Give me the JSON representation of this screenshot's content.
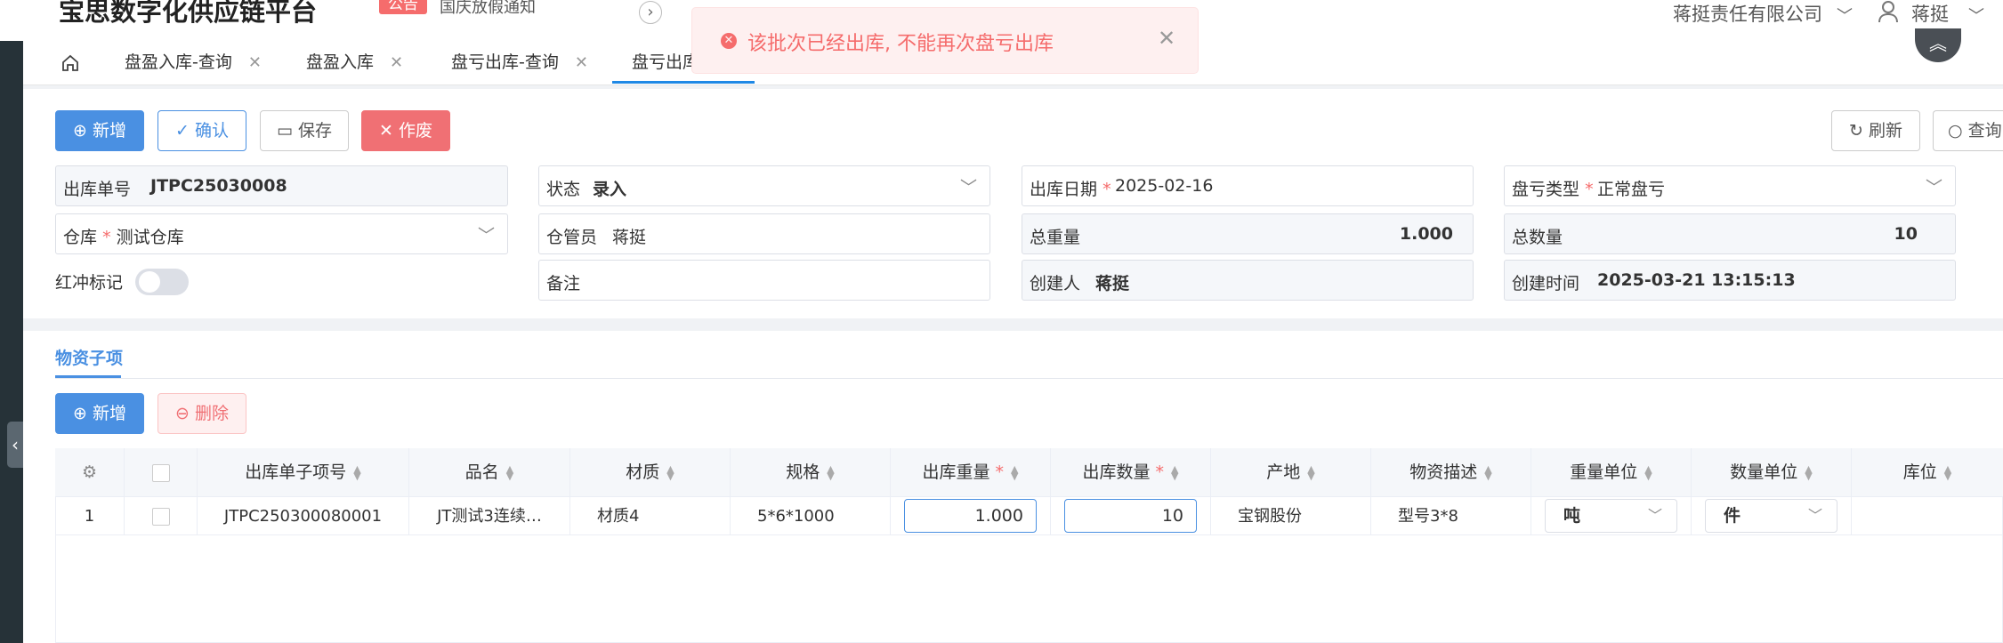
{
  "header": {
    "brand": "宝思数字化供应链平台",
    "notice_badge": "公告",
    "notice_text": "国庆放假通知",
    "company": "蒋挺责任有限公司",
    "user": "蒋挺"
  },
  "tabs": [
    {
      "label": "盘盈入库-查询"
    },
    {
      "label": "盘盈入库"
    },
    {
      "label": "盘亏出库-查询"
    },
    {
      "label": "盘亏出库"
    }
  ],
  "toast": {
    "message": "该批次已经出库, 不能再次盘亏出库"
  },
  "toolbar": {
    "add": "新增",
    "confirm": "确认",
    "save": "保存",
    "void": "作废",
    "refresh": "刷新",
    "query": "查询"
  },
  "form": {
    "order_no_label": "出库单号",
    "order_no": "JTPC25030008",
    "status_label": "状态",
    "status": "录入",
    "date_label": "出库日期",
    "date": "2025-02-16",
    "loss_type_label": "盘亏类型",
    "loss_type": "正常盘亏",
    "warehouse_label": "仓库",
    "warehouse": "测试仓库",
    "keeper_label": "仓管员",
    "keeper": "蒋挺",
    "total_weight_label": "总重量",
    "total_weight": "1.000",
    "total_qty_label": "总数量",
    "total_qty": "10",
    "red_flag_label": "红冲标记",
    "remark_label": "备注",
    "creator_label": "创建人",
    "creator": "蒋挺",
    "created_time_label": "创建时间",
    "created_time": "2025-03-21 13:15:13"
  },
  "detail": {
    "tab": "物资子项",
    "add": "新增",
    "delete": "删除",
    "columns": {
      "item_no": "出库单子项号",
      "name": "品名",
      "material": "材质",
      "spec": "规格",
      "out_weight": "出库重量",
      "out_qty": "出库数量",
      "origin": "产地",
      "desc": "物资描述",
      "weight_unit": "重量单位",
      "qty_unit": "数量单位",
      "location": "库位"
    },
    "rows": [
      {
        "index": "1",
        "item_no": "JTPC250300080001",
        "name": "JT测试3连续…",
        "material": "材质4",
        "spec": "5*6*1000",
        "out_weight": "1.000",
        "out_qty": "10",
        "origin": "宝钢股份",
        "desc": "型号3*8",
        "weight_unit": "吨",
        "qty_unit": "件",
        "location": ""
      }
    ]
  },
  "colors": {
    "primary": "#4a90e2",
    "danger": "#f07074",
    "toast_bg": "#fef0f0",
    "sidebar": "#263238"
  }
}
